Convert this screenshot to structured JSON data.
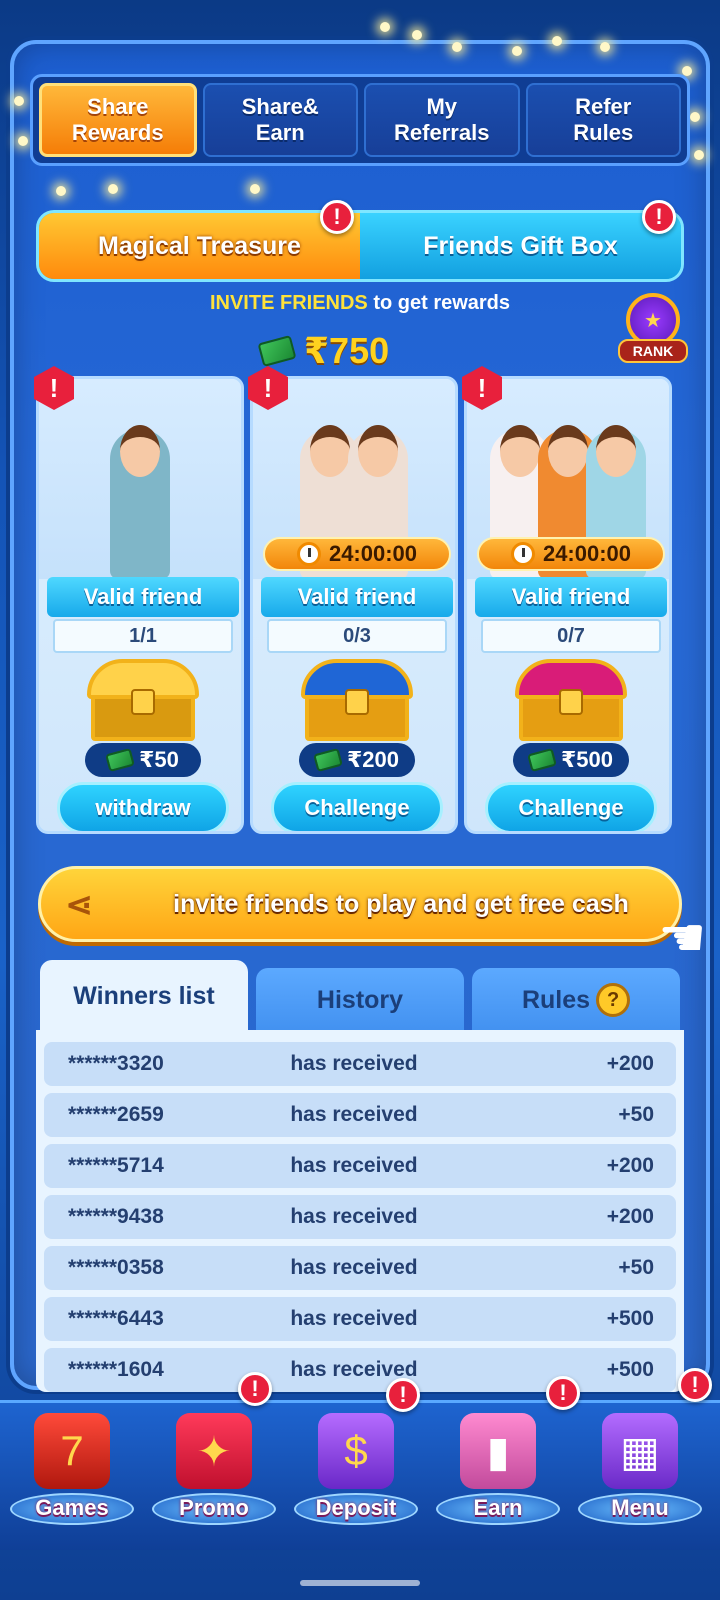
{
  "top_tabs": [
    {
      "label": "Share\nRewards"
    },
    {
      "label": "Share&\nEarn"
    },
    {
      "label": "My\nReferrals"
    },
    {
      "label": "Refer\nRules"
    }
  ],
  "sub_tabs": {
    "magical": "Magical Treasure",
    "friends": "Friends Gift Box"
  },
  "invite": {
    "highlight": "INVITE FRIENDS",
    "rest": " to get  rewards",
    "total": "₹750"
  },
  "rank": {
    "label": "RANK"
  },
  "cards": [
    {
      "valid_label": "Valid friend",
      "progress": "1/1",
      "reward": "₹50",
      "button": "withdraw"
    },
    {
      "timer": "24:00:00",
      "valid_label": "Valid friend",
      "progress": "0/3",
      "reward": "₹200",
      "button": "Challenge"
    },
    {
      "timer": "24:00:00",
      "valid_label": "Valid friend",
      "progress": "0/7",
      "reward": "₹500",
      "button": "Challenge"
    }
  ],
  "invite_button": "invite friends to play and get free cash",
  "list_tabs": {
    "winners": "Winners list",
    "history": "History",
    "rules": "Rules"
  },
  "winners": [
    {
      "name": "******3320",
      "status": "has received",
      "value": "+200"
    },
    {
      "name": "******2659",
      "status": "has received",
      "value": "+50"
    },
    {
      "name": "******5714",
      "status": "has received",
      "value": "+200"
    },
    {
      "name": "******9438",
      "status": "has received",
      "value": "+200"
    },
    {
      "name": "******0358",
      "status": "has received",
      "value": "+50"
    },
    {
      "name": "******6443",
      "status": "has received",
      "value": "+500"
    },
    {
      "name": "******1604",
      "status": "has received",
      "value": "+500"
    }
  ],
  "nav": [
    {
      "label": "Games",
      "icon": "slot-machine-icon"
    },
    {
      "label": "Promo",
      "icon": "gift-icon"
    },
    {
      "label": "Deposit",
      "icon": "wallet-icon"
    },
    {
      "label": "Earn",
      "icon": "phone-icon"
    },
    {
      "label": "Menu",
      "icon": "menu-book-icon"
    }
  ],
  "colors": {
    "accent_orange": "#f57d07",
    "accent_cyan": "#17a9ea",
    "alert_red": "#e8203c",
    "gold": "#ffd21f"
  }
}
